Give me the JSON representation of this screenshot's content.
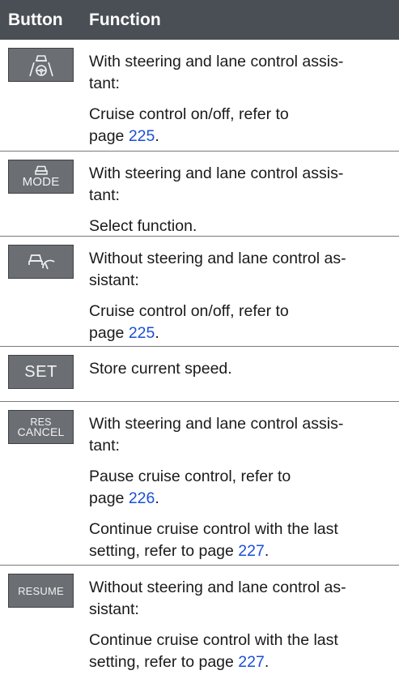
{
  "header": {
    "col_button": "Button",
    "col_function": "Function"
  },
  "rows": [
    {
      "icon": "cruise-control-steering-assist-icon",
      "lines": [
        {
          "text": "With steering and lane control assis-\ntant:"
        },
        {
          "text_before": "Cruise control on/off, refer to\npage ",
          "link": "225",
          "text_after": "."
        }
      ]
    },
    {
      "icon": "mode-icon",
      "button_label": "MODE",
      "lines": [
        {
          "text": "With steering and lane control assis-\ntant:"
        },
        {
          "text": "Select function."
        }
      ]
    },
    {
      "icon": "cruise-control-icon",
      "lines": [
        {
          "text": "Without steering and lane control as-\nsistant:"
        },
        {
          "text_before": "Cruise control on/off, refer to\npage ",
          "link": "225",
          "text_after": "."
        }
      ]
    },
    {
      "icon": "set-icon",
      "button_label": "SET",
      "lines": [
        {
          "text": "Store current speed."
        }
      ]
    },
    {
      "icon": "res-cancel-icon",
      "button_label_top": "RES",
      "button_label_bottom": "CANCEL",
      "lines": [
        {
          "text": "With steering and lane control assis-\ntant:"
        },
        {
          "text_before": "Pause cruise control, refer to\npage ",
          "link": "226",
          "text_after": "."
        },
        {
          "text_before": "Continue cruise control with the last\nsetting, refer to page ",
          "link": "227",
          "text_after": "."
        }
      ]
    },
    {
      "icon": "resume-icon",
      "button_label": "RESUME",
      "lines": [
        {
          "text": "Without steering and lane control as-\nsistant:"
        },
        {
          "text_before": "Continue cruise control with the last\nsetting, refer to page ",
          "link": "227",
          "text_after": "."
        }
      ]
    }
  ]
}
